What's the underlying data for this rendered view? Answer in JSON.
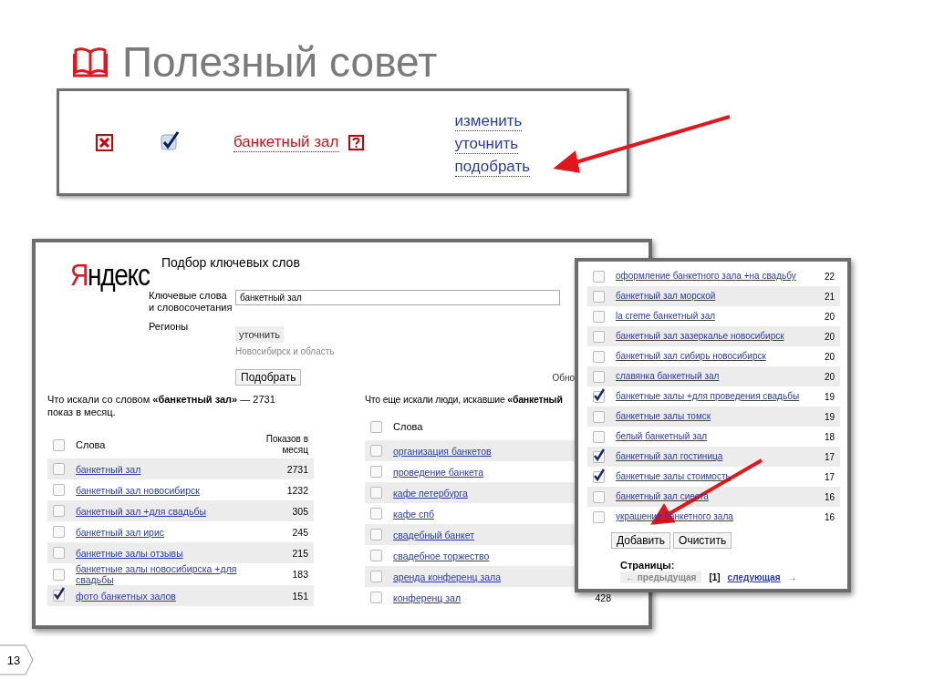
{
  "slide": {
    "title": "Полезный совет",
    "page_number": "13"
  },
  "tip_box": {
    "keyword": "банкетный зал",
    "checked": true,
    "links": [
      "изменить",
      "уточнить",
      "подобрать"
    ]
  },
  "main_window": {
    "logo": "Яндекс",
    "heading": "Подбор ключевых слов",
    "keywords_label": "Ключевые слова и словосочетания",
    "keywords_value": "банкетный зал",
    "regions_label": "Регионы",
    "regions_button": "уточнить",
    "regions_value": "Новосибирск и область",
    "submit": "Подобрать",
    "update_text": "Обно",
    "left": {
      "description": "Что искали со словом **«банкетный зал»** — 2731 показ в месяц.",
      "columns": [
        "Слова",
        "Показов в месяц"
      ],
      "all_checked": false,
      "rows": [
        {
          "phrase": "банкетный зал",
          "count": "2731",
          "checked": false
        },
        {
          "phrase": "банкетный зал новосибирск",
          "count": "1232",
          "checked": false
        },
        {
          "phrase": "банкетный зал +для свадьбы",
          "count": "305",
          "checked": false
        },
        {
          "phrase": "банкетный зал ирис",
          "count": "245",
          "checked": false
        },
        {
          "phrase": "банкетные залы отзывы",
          "count": "215",
          "checked": false
        },
        {
          "phrase": "банкетные залы новосибирска +для свадьбы",
          "count": "183",
          "checked": false
        },
        {
          "phrase": "фото банкетных залов",
          "count": "151",
          "checked": true
        }
      ]
    },
    "right": {
      "description": "Что еще искали люди, искавшие **«банкетный**",
      "columns": [
        "Слова"
      ],
      "all_checked": false,
      "rows": [
        {
          "phrase": "организация банкетов",
          "checked": false
        },
        {
          "phrase": "проведение банкета",
          "checked": false
        },
        {
          "phrase": "кафе петербурга",
          "checked": false
        },
        {
          "phrase": "кафе спб",
          "checked": false
        },
        {
          "phrase": "свадебный банкет",
          "checked": false
        },
        {
          "phrase": "свадебное торжество",
          "checked": false
        },
        {
          "phrase": "аренда конференц зала",
          "checked": false
        },
        {
          "phrase": "конференц зал",
          "count": "428",
          "checked": false
        }
      ]
    }
  },
  "popup": {
    "rows": [
      {
        "phrase": "оформление банкетного зала +на свадьбу",
        "count": "22",
        "checked": false
      },
      {
        "phrase": "банкетный зал морской",
        "count": "21",
        "checked": false
      },
      {
        "phrase": "la creme банкетный зал",
        "count": "20",
        "checked": false
      },
      {
        "phrase": "банкетный зал зазеркалье новосибирск",
        "count": "20",
        "checked": false
      },
      {
        "phrase": "банкетный зал сибирь новосибирск",
        "count": "20",
        "checked": false
      },
      {
        "phrase": "славянка банкетный зал",
        "count": "20",
        "checked": false
      },
      {
        "phrase": "банкетные залы +для проведения свадьбы",
        "count": "19",
        "checked": true
      },
      {
        "phrase": "банкетные залы томск",
        "count": "19",
        "checked": false
      },
      {
        "phrase": "белый банкетный зал",
        "count": "18",
        "checked": false
      },
      {
        "phrase": "банкетный зал гостиница",
        "count": "17",
        "checked": true
      },
      {
        "phrase": "банкетные залы стоимость",
        "count": "17",
        "checked": true
      },
      {
        "phrase": "банкетный зал сиеста",
        "count": "16",
        "checked": false
      },
      {
        "phrase": "украшение банкетного зала",
        "count": "16",
        "checked": false
      }
    ],
    "buttons": [
      "Добавить",
      "Очистить"
    ],
    "pages_label": "Страницы:",
    "prev": "← предыдущая",
    "current": "[1]",
    "next": "следующая",
    "next_arrow": "→"
  }
}
